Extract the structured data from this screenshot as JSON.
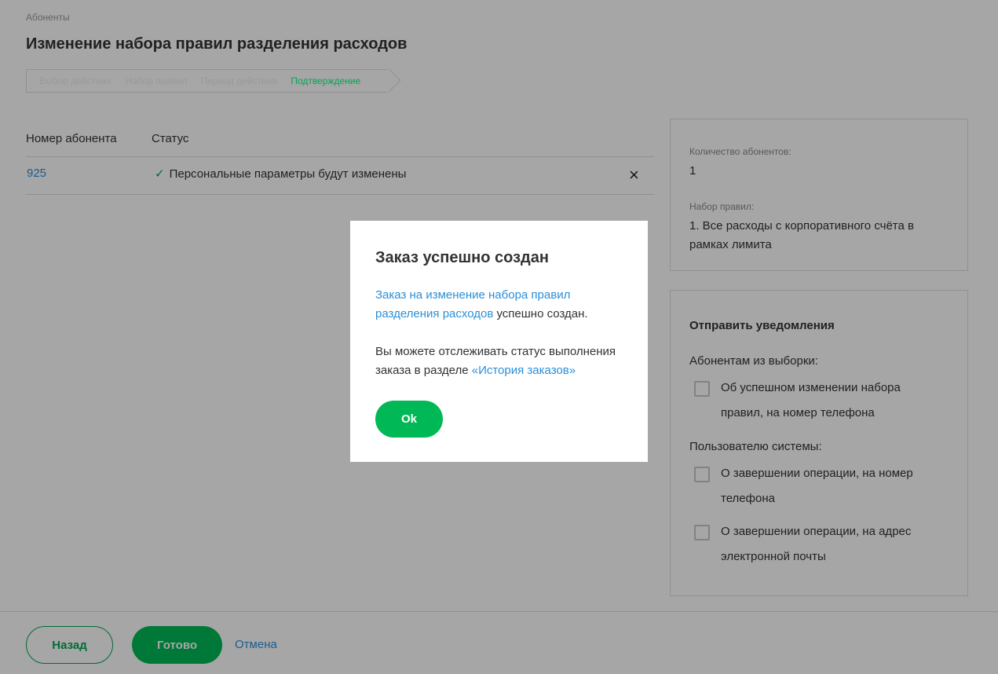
{
  "breadcrumb": {
    "section": "Абоненты"
  },
  "page": {
    "title": "Изменение набора правил разделения расходов"
  },
  "wizard": {
    "steps": [
      {
        "label": "Выбор действия",
        "active": false
      },
      {
        "label": "Набор правил",
        "active": false
      },
      {
        "label": "Период действия",
        "active": false
      },
      {
        "label": "Подтверждение",
        "active": true
      }
    ]
  },
  "table": {
    "headers": {
      "number": "Номер абонента",
      "status": "Статус"
    },
    "rows": [
      {
        "number": "925",
        "status": "Персональные параметры будут изменены",
        "status_icon": "check-icon",
        "action_icon": "close-icon"
      }
    ]
  },
  "summary": {
    "count_label": "Количество абонентов:",
    "count_value": "1",
    "ruleset_label": "Набор правил:",
    "ruleset_value": "1. Все расходы с корпоративного счёта в рамках лимита"
  },
  "notify": {
    "title": "Отправить уведомления",
    "group1_label": "Абонентам из выборки:",
    "group1_items": [
      {
        "label": "Об успешном изменении набора правил, на номер телефона",
        "checked": false
      }
    ],
    "group2_label": "Пользователю системы:",
    "group2_items": [
      {
        "label": "О завершении операции, на номер телефона",
        "checked": false
      },
      {
        "label": "О завершении операции, на адрес электронной почты",
        "checked": false
      }
    ]
  },
  "footer": {
    "back_label": "Назад",
    "done_label": "Готово",
    "cancel_label": "Отмена"
  },
  "modal": {
    "title": "Заказ успешно создан",
    "order_link": "Заказ на изменение набора правил разделения расходов",
    "order_suffix": " успешно создан.",
    "track_text": "Вы можете отслеживать статус выполнения заказа в разделе ",
    "history_link": "«История заказов»",
    "ok_label": "Ok"
  },
  "colors": {
    "accent": "#00b956",
    "link": "#2b8fd8",
    "overlay": "rgba(0,0,0,0.35)"
  }
}
